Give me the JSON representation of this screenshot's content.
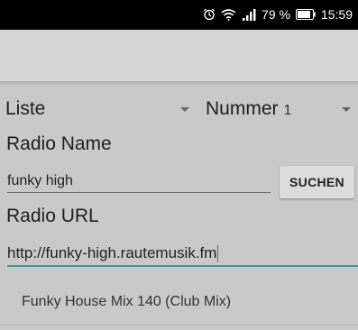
{
  "status_bar": {
    "battery": "79 %",
    "time": "15:59",
    "icons": [
      "alarm-icon",
      "wifi-icon",
      "signal-icon",
      "battery-icon"
    ]
  },
  "form": {
    "liste_label": "Liste",
    "nummer_label": "Nummer",
    "nummer_value": "1",
    "radio_name_label": "Radio Name",
    "radio_name_value": "funky high",
    "search_button": "SUCHEN",
    "radio_url_label": "Radio URL",
    "radio_url_value": "http://funky-high.rautemusik.fm"
  },
  "results": [
    {
      "title": "Funky House Mix 140 (Club Mix)"
    }
  ],
  "colors": {
    "accent": "#2e9e93",
    "background": "#c9c9c9",
    "status_bar": "#000000"
  }
}
